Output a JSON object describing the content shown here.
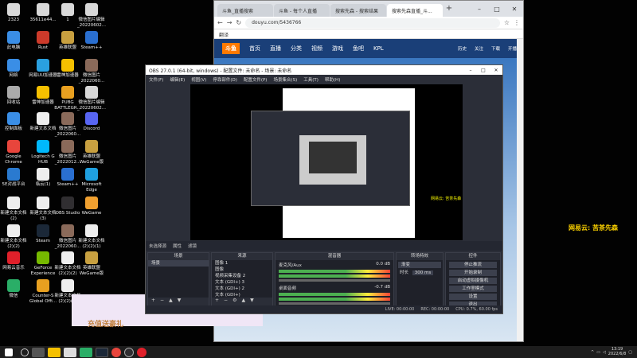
{
  "desktop_icons": [
    {
      "label": "2323",
      "color": "#d8d8d8"
    },
    {
      "label": "35611e44...",
      "color": "#d8d8d8"
    },
    {
      "label": "1",
      "color": "#d8d8d8"
    },
    {
      "label": "微信图片编辑_20220602...",
      "color": "#d8d8d8"
    },
    {
      "label": "此电脑",
      "color": "#3a8ee6"
    },
    {
      "label": "Rust",
      "color": "#cc3a2a"
    },
    {
      "label": "英雄联盟",
      "color": "#c8a040"
    },
    {
      "label": "Steam++",
      "color": "#2a6fd0"
    },
    {
      "label": "网络",
      "color": "#3a8ee6"
    },
    {
      "label": "网易UU加速器",
      "color": "#2aa0e0"
    },
    {
      "label": "雷神加速器",
      "color": "#f5c000"
    },
    {
      "label": "微信图片_2022060...",
      "color": "#8a6a5a"
    },
    {
      "label": "回收站",
      "color": "#aaa"
    },
    {
      "label": "雷神加速器",
      "color": "#f5c000"
    },
    {
      "label": "PUBG BATTLEGR...",
      "color": "#e8a020"
    },
    {
      "label": "微信图片编辑_20220602...",
      "color": "#d8d8d8"
    },
    {
      "label": "控制面板",
      "color": "#3a8ee6"
    },
    {
      "label": "新建文本文档",
      "color": "#eee"
    },
    {
      "label": "微信图片_2022060...",
      "color": "#8a6a5a"
    },
    {
      "label": "Discord",
      "color": "#5865f2"
    },
    {
      "label": "Google Chrome",
      "color": "#e8453c"
    },
    {
      "label": "Logitech G HUB",
      "color": "#00b8fc"
    },
    {
      "label": "微信图片_2022012...",
      "color": "#8a6a5a"
    },
    {
      "label": "英雄联盟 WeGame版",
      "color": "#c8a040"
    },
    {
      "label": "5E对战平台",
      "color": "#2a7ad0"
    },
    {
      "label": "临云(1)",
      "color": "#eee"
    },
    {
      "label": "Steam++",
      "color": "#2a6fd0"
    },
    {
      "label": "Microsoft Edge",
      "color": "#1fa0e0"
    },
    {
      "label": "新建文本文档 (2)",
      "color": "#eee"
    },
    {
      "label": "新建文本文档 (3)",
      "color": "#eee"
    },
    {
      "label": "OBS Studio",
      "color": "#302e31"
    },
    {
      "label": "WeGame",
      "color": "#f0a030"
    },
    {
      "label": "新建文本文档 (2)(2)",
      "color": "#eee"
    },
    {
      "label": "Steam",
      "color": "#1b2838"
    },
    {
      "label": "微信图片_2022060...",
      "color": "#8a6a5a"
    },
    {
      "label": "新建文本文档 (2)(2)(1)",
      "color": "#eee"
    },
    {
      "label": "网易云音乐",
      "color": "#e0202a"
    },
    {
      "label": "GeForce Experience",
      "color": "#76b900"
    },
    {
      "label": "新建文本文档 (2)(2)(2)",
      "color": "#eee"
    },
    {
      "label": "英雄联盟 WeGame版",
      "color": "#c8a040"
    },
    {
      "label": "微信",
      "color": "#2aae67"
    },
    {
      "label": "Counter-S Global Offi...",
      "color": "#e8a020"
    },
    {
      "label": "新建文本文档 (2)(2)(3)",
      "color": "#eee"
    }
  ],
  "browser": {
    "tabs": [
      "斗鱼_直播搜索",
      "斗鱼 - 每个人直播",
      "搜索先森 - 搜索结果",
      "搜索先森直播_斗..."
    ],
    "active_tab": 3,
    "url": "douyu.com/5436766",
    "bookmark": "翻译",
    "site_nav": [
      "首页",
      "直播",
      "分类",
      "视频",
      "游戏",
      "鱼吧",
      "KPL"
    ],
    "site_logo": "斗鱼",
    "site_right": [
      "历史",
      "关注",
      "下载",
      "开播"
    ],
    "promo_text": "充值送豪礼"
  },
  "obs": {
    "title": "OBS 27.0.1 (64-bit, windows) - 配置文件: 未命名 - 场景: 未命名",
    "menu": [
      "文件(F)",
      "编辑(E)",
      "视图(V)",
      "停靠部件(D)",
      "配置文件(P)",
      "场景集合(S)",
      "工具(T)",
      "帮助(H)"
    ],
    "preview_caption": "网易云: 苦茶先森",
    "source_bar": "未选择源",
    "props_label": "属性",
    "filters_label": "滤镜",
    "docks": {
      "scenes": {
        "title": "场景",
        "items": [
          "场景"
        ]
      },
      "sources": {
        "title": "来源",
        "items": [
          "图像 1",
          "图像",
          "视频采集设备 2",
          "文本 (GDI+) 3",
          "文本 (GDI+) 2",
          "文本 (GDI+)"
        ]
      },
      "mixer": {
        "title": "混音器",
        "channels": [
          {
            "name": "麦克风/Aux",
            "level": "0.0 dB"
          },
          {
            "name": "桌面音频",
            "level": "-0.7 dB"
          }
        ]
      },
      "transitions": {
        "title": "转场特效",
        "fade": "渐变",
        "duration_label": "时长",
        "duration": "300 ms"
      },
      "controls": {
        "title": "控件",
        "buttons": [
          "停止推流",
          "开始录制",
          "启动虚拟摄像机",
          "工作室模式",
          "设置",
          "退出"
        ]
      }
    },
    "status": [
      "LIVE: 00:00:00",
      "REC: 00:00:00",
      "CPU: 0.7%, 60.00 fps"
    ]
  },
  "overlay_text": "网易云: 苦茶先森",
  "taskbar": {
    "items": [
      "start",
      "search",
      "task-view",
      "explorer",
      "file",
      "wechat",
      "steam",
      "chrome",
      "obs",
      "netease"
    ],
    "time": "13:19",
    "date": "2022/6/8"
  }
}
